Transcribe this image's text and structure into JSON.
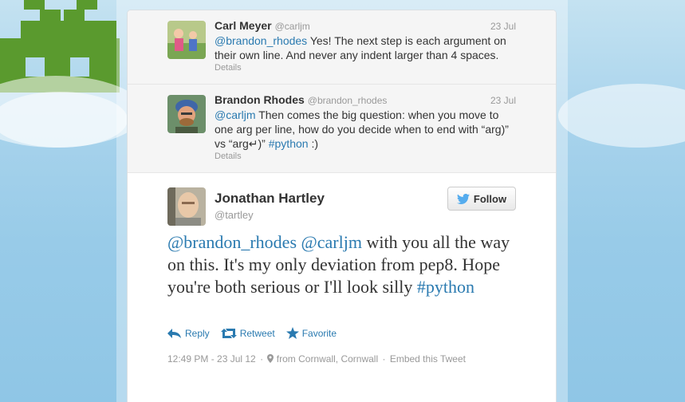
{
  "replies": [
    {
      "fullname": "Carl Meyer",
      "username": "@carljm",
      "time": "23 Jul",
      "mentions": [
        "@brandon_rhodes"
      ],
      "text": "Yes! The next step is each argument on their own line. And never any indent larger than 4 spaces.",
      "details": "Details"
    },
    {
      "fullname": "Brandon Rhodes",
      "username": "@brandon_rhodes",
      "time": "23 Jul",
      "mentions": [
        "@carljm"
      ],
      "text_part1": "Then comes the big question: when you move to one arg per line, how do you decide when to end with “arg)” vs “arg↵)”",
      "hashtag": "#python",
      "text_part2": ":)",
      "details": "Details"
    }
  ],
  "main": {
    "fullname": "Jonathan Hartley",
    "username": "@tartley",
    "follow_label": "Follow",
    "mention1": "@brandon_rhodes",
    "mention2": "@carljm",
    "text": "with you all the way on this. It's my only deviation from pep8. Hope you're both serious or I'll look silly",
    "hashtag": "#python",
    "actions": {
      "reply": "Reply",
      "retweet": "Retweet",
      "favorite": "Favorite"
    },
    "timestamp": "12:49 PM - 23 Jul 12",
    "location": "from Cornwall, Cornwall",
    "embed": "Embed this Tweet"
  },
  "colors": {
    "link": "#2a7ab0",
    "invader": "#5a9a2e",
    "background": "#a8d3ec"
  },
  "icons": [
    "twitter-bird-icon",
    "reply-icon",
    "retweet-icon",
    "favorite-star-icon",
    "location-pin-icon"
  ]
}
